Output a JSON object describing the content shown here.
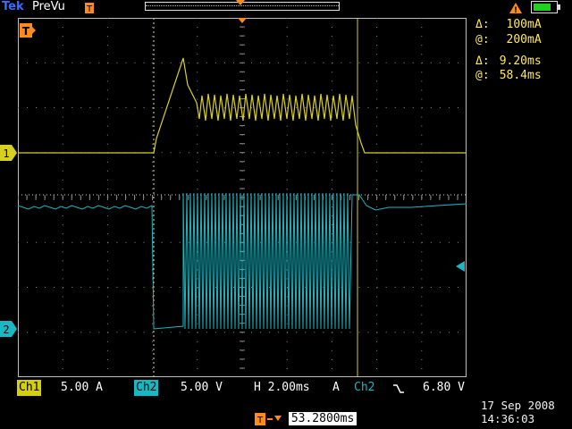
{
  "header": {
    "brand": "Tek",
    "mode": "PreVu"
  },
  "cursors": {
    "current": {
      "delta": "100mA",
      "at": "200mA"
    },
    "time": {
      "delta": "9.20ms",
      "at": "58.4ms"
    },
    "delta_symbol": "Δ:",
    "at_symbol": "@:"
  },
  "markers": {
    "ch1": "1",
    "ch2": "2",
    "trigger": "T"
  },
  "footer": {
    "ch1_label": "Ch1",
    "ch1_scale": "5.00 A",
    "ch2_label": "Ch2",
    "ch2_scale": "5.00 V",
    "horizontal": "H 2.00ms",
    "trigger_mode": "A",
    "trigger_source": "Ch2",
    "trigger_slope_icon": "falling-edge-icon",
    "trigger_level": "6.80 V",
    "trigger_position": "53.2800ms",
    "date": "17 Sep 2008",
    "time": "14:36:03"
  },
  "colors": {
    "ch1": "#d8d020",
    "ch2": "#18b8c4",
    "trigger": "#ff8c1a",
    "grid": "#8a8a8a"
  }
}
